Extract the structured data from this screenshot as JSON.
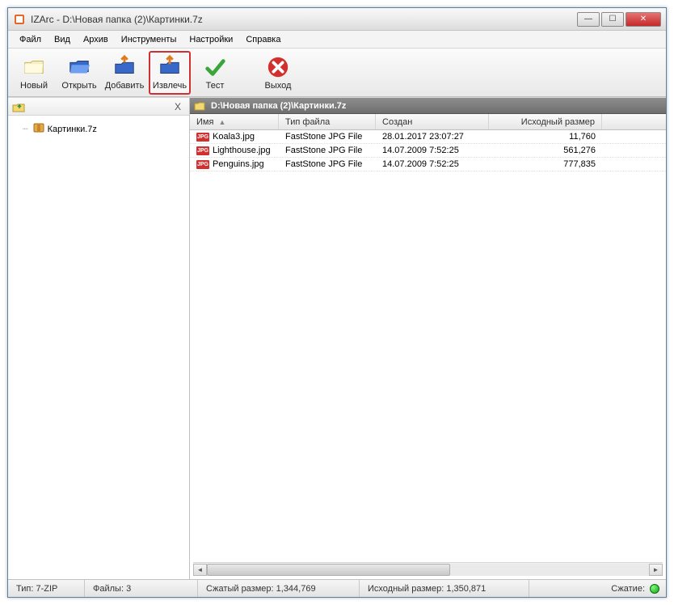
{
  "title": "IZArc - D:\\Новая папка (2)\\Картинки.7z",
  "menu": {
    "file": "Файл",
    "view": "Вид",
    "archive": "Архив",
    "tools": "Инструменты",
    "settings": "Настройки",
    "help": "Справка"
  },
  "toolbar": {
    "new": "Новый",
    "open": "Открыть",
    "add": "Добавить",
    "extract": "Извлечь",
    "test": "Тест",
    "exit": "Выход"
  },
  "tree": {
    "root": "Картинки.7z"
  },
  "path": "D:\\Новая папка (2)\\Картинки.7z",
  "columns": {
    "name": "Имя",
    "type": "Тип файла",
    "created": "Создан",
    "size": "Исходный размер"
  },
  "rows": [
    {
      "name": "Koala3.jpg",
      "type": "FastStone JPG File",
      "date": "28.01.2017 23:07:27",
      "size": "11,760"
    },
    {
      "name": "Lighthouse.jpg",
      "type": "FastStone JPG File",
      "date": "14.07.2009 7:52:25",
      "size": "561,276"
    },
    {
      "name": "Penguins.jpg",
      "type": "FastStone JPG File",
      "date": "14.07.2009 7:52:25",
      "size": "777,835"
    }
  ],
  "status": {
    "type_label": "Тип:",
    "type_value": "7-ZIP",
    "files_label": "Файлы:",
    "files_value": "3",
    "packed_label": "Сжатый размер:",
    "packed_value": "1,344,769",
    "orig_label": "Исходный размер:",
    "orig_value": "1,350,871",
    "ratio_label": "Сжатие:"
  },
  "icons": {
    "jpg": "JPG"
  }
}
